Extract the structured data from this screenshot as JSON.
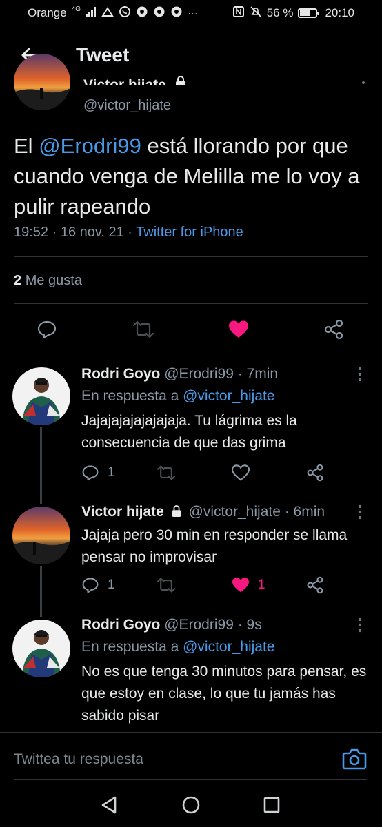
{
  "status_bar": {
    "carrier": "Orange",
    "network": "4G",
    "battery": "56 %",
    "time": "20:10"
  },
  "header": {
    "title": "Tweet"
  },
  "main_tweet": {
    "name": "Victor hijate",
    "handle": "@victor_hijate",
    "text_before": "El ",
    "mention": "@Erodri99",
    "text_after": " está llorando por que cuando venga de Melilla me lo voy a pulir rapeando",
    "time": "19:52 · 16 nov. 21 · ",
    "source": "Twitter for iPhone",
    "likes_count": "2",
    "likes_label": "Me gusta"
  },
  "replies": [
    {
      "name": "Rodri Goyo",
      "handle": "@Erodri99 · 7min",
      "in_reply_label": "En respuesta a ",
      "in_reply_mention": "@victor_hijate",
      "text": "Jajajajajajajajaja. Tu lágrima es la consecuencia de que das grima",
      "reply_count": "1",
      "like_count": "",
      "liked": false
    },
    {
      "name": "Victor hijate",
      "handle": "@victor_hijate · 6min",
      "text": "Jajaja pero 30 min en responder se llama pensar no improvisar",
      "reply_count": "1",
      "like_count": "1",
      "liked": true
    },
    {
      "name": "Rodri Goyo",
      "handle": "@Erodri99 · 9s",
      "in_reply_label": "En respuesta a ",
      "in_reply_mention": "@victor_hijate",
      "text": "No es que tenga 30 minutos para pensar, es que estoy en clase, lo que tu jamás has sabido pisar"
    }
  ],
  "composer": {
    "placeholder": "Twittea tu respuesta"
  },
  "colors": {
    "accent": "#4a99e9",
    "like": "#f91880",
    "muted": "#8b98a5",
    "background": "#000000"
  },
  "icons": [
    "back-arrow-icon",
    "reply-icon",
    "retweet-icon",
    "heart-icon",
    "share-icon",
    "more-icon",
    "lock-icon",
    "verified-icon",
    "camera-icon",
    "nav-back-icon",
    "nav-home-icon",
    "nav-recents-icon"
  ]
}
